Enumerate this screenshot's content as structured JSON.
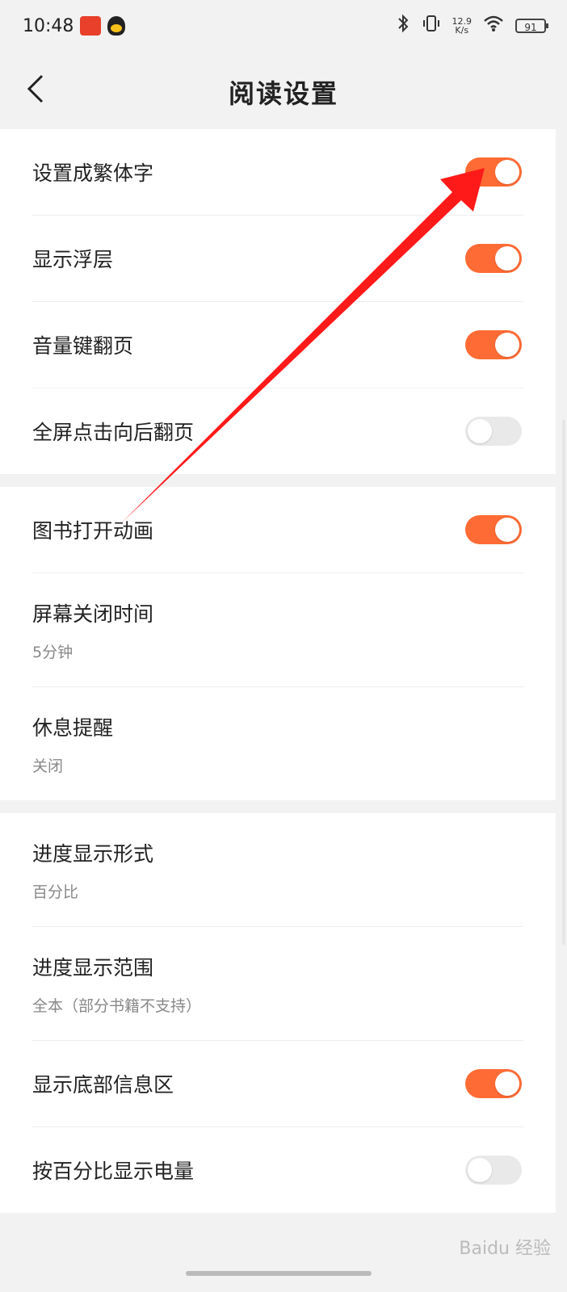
{
  "status_bar": {
    "time": "10:48",
    "net_speed": "12.9",
    "net_unit": "K/s",
    "battery": "91"
  },
  "header": {
    "title": "阅读设置"
  },
  "groups": [
    {
      "items": [
        {
          "label": "设置成繁体字",
          "toggle": true
        },
        {
          "label": "显示浮层",
          "toggle": true
        },
        {
          "label": "音量键翻页",
          "toggle": true
        },
        {
          "label": "全屏点击向后翻页",
          "toggle": false
        }
      ]
    },
    {
      "items": [
        {
          "label": "图书打开动画",
          "toggle": true
        },
        {
          "label": "屏幕关闭时间",
          "value": "5分钟"
        },
        {
          "label": "休息提醒",
          "value": "关闭"
        }
      ]
    },
    {
      "items": [
        {
          "label": "进度显示形式",
          "value": "百分比"
        },
        {
          "label": "进度显示范围",
          "value": "全本（部分书籍不支持）"
        },
        {
          "label": "显示底部信息区",
          "toggle": true
        },
        {
          "label": "按百分比显示电量",
          "toggle": false
        }
      ]
    }
  ],
  "colors": {
    "toggle_on": "#ff6b35",
    "toggle_off": "#e9e9e9",
    "annotation_arrow": "#ff1a1a"
  },
  "watermark": "Baidu 经验"
}
